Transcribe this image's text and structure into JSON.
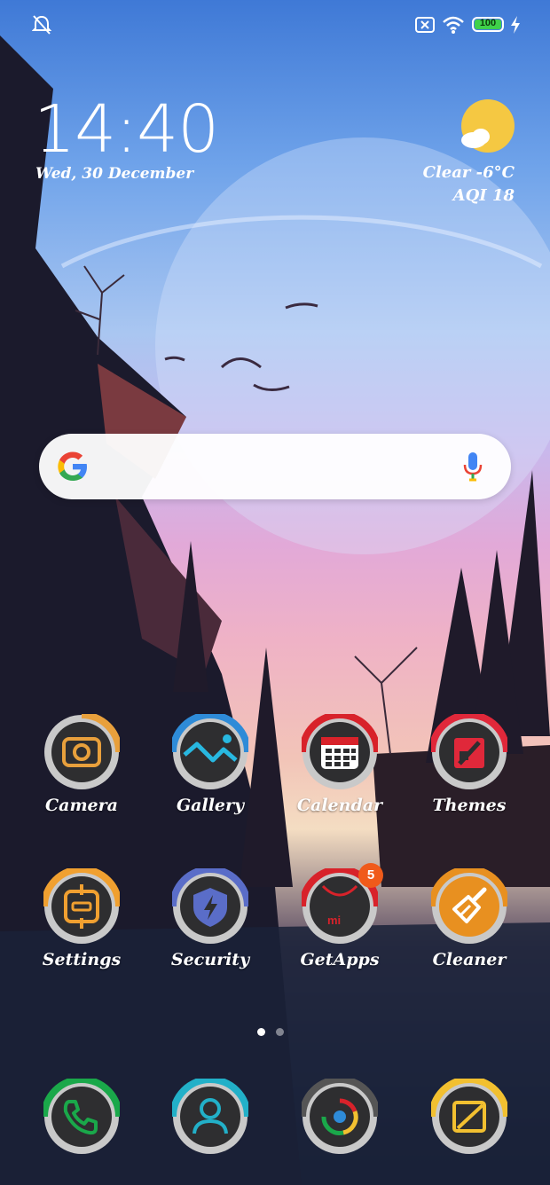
{
  "status_bar": {
    "silent_icon": "bell-off-icon",
    "sim_icon": "no-sim-icon",
    "wifi_icon": "wifi-icon",
    "battery_level": "100",
    "charging_icon": "bolt-icon"
  },
  "clock": {
    "time": "14:40",
    "date": "Wed, 30 December"
  },
  "weather": {
    "condition": "Clear  -6°C",
    "aqi": "AQI 18",
    "icon": "sun-cloud-icon"
  },
  "search_bar": {
    "logo": "google-g-icon",
    "mic": "mic-icon"
  },
  "apps_row1": [
    {
      "label": "Camera",
      "icon": "camera-icon",
      "accent": "#e8a03c"
    },
    {
      "label": "Gallery",
      "icon": "gallery-icon",
      "accent": "#2e8bd8"
    },
    {
      "label": "Calendar",
      "icon": "calendar-icon",
      "accent": "#d8222a"
    },
    {
      "label": "Themes",
      "icon": "themes-icon",
      "accent": "#e0283a"
    }
  ],
  "apps_row2": [
    {
      "label": "Settings",
      "icon": "settings-icon",
      "accent": "#f0a030"
    },
    {
      "label": "Security",
      "icon": "security-shield-icon",
      "accent": "#5a6dc8"
    },
    {
      "label": "GetApps",
      "icon": "getapps-icon",
      "accent": "#d8222a",
      "badge": "5"
    },
    {
      "label": "Cleaner",
      "icon": "cleaner-broom-icon",
      "accent": "#e89020"
    }
  ],
  "page_indicator": {
    "pages": 2,
    "active": 1
  },
  "dock": [
    {
      "icon": "phone-icon",
      "accent": "#1aa84a"
    },
    {
      "icon": "contacts-icon",
      "accent": "#22b0c8"
    },
    {
      "icon": "chrome-icon",
      "accent": "#555555"
    },
    {
      "icon": "notes-icon",
      "accent": "#f2c030"
    }
  ],
  "colors": {
    "battery_fill": "#3fd14a",
    "badge": "#f05a1a",
    "icon_ring": "#c9c9c9",
    "icon_face": "#2e2e30"
  }
}
